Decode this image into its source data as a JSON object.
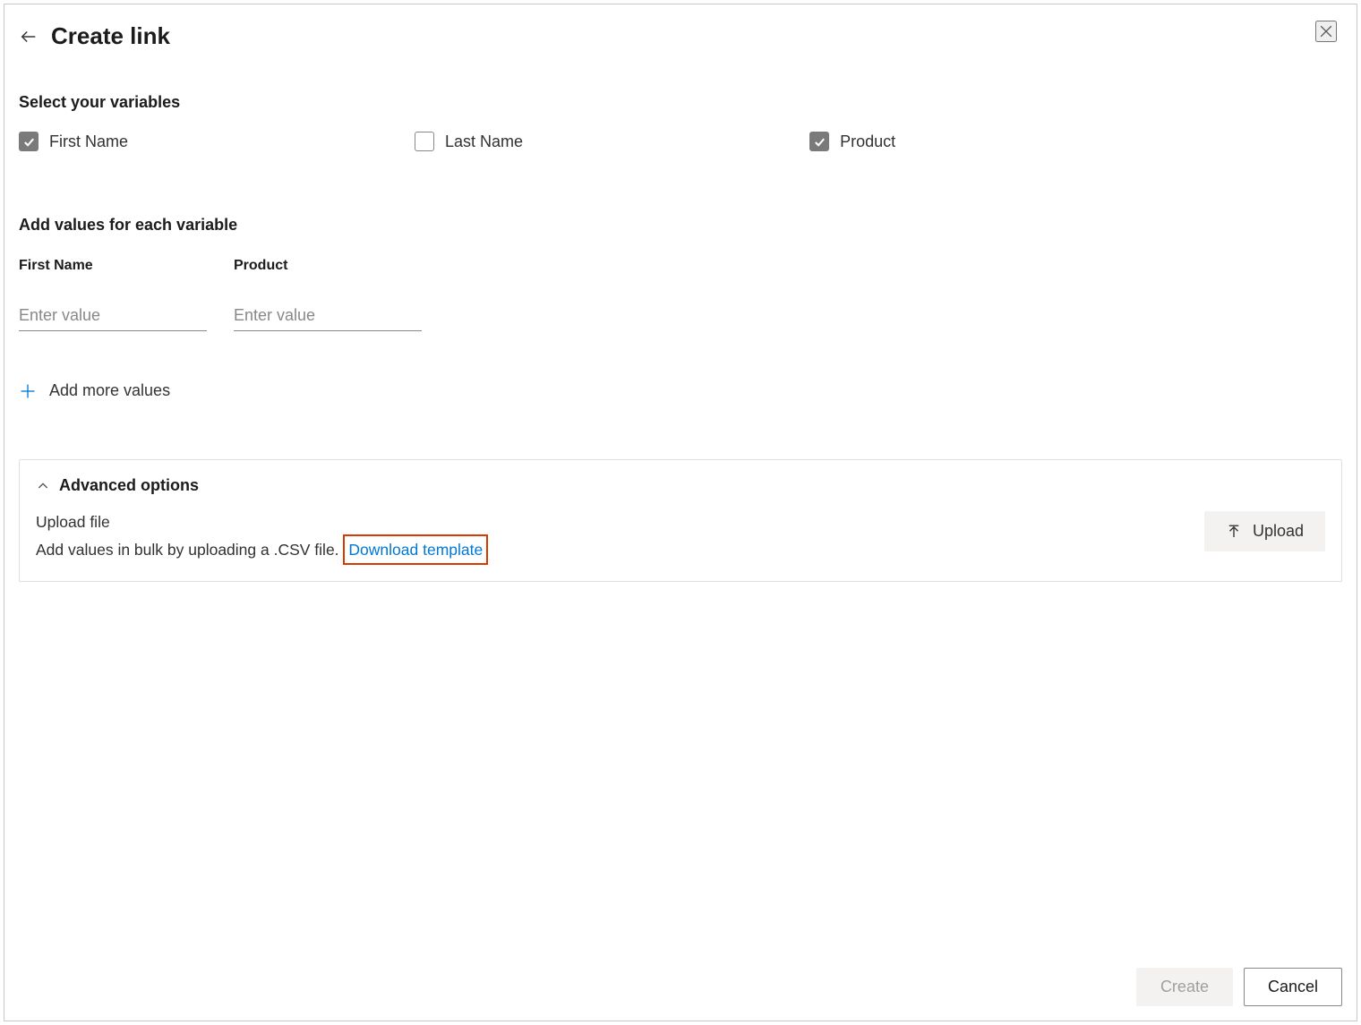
{
  "header": {
    "title": "Create link"
  },
  "variables": {
    "heading": "Select your variables",
    "items": [
      {
        "label": "First Name",
        "checked": true
      },
      {
        "label": "Last Name",
        "checked": false
      },
      {
        "label": "Product",
        "checked": true
      }
    ]
  },
  "values": {
    "heading": "Add values for each variable",
    "columns": [
      {
        "label": "First Name",
        "placeholder": "Enter value",
        "value": ""
      },
      {
        "label": "Product",
        "placeholder": "Enter value",
        "value": ""
      }
    ],
    "add_more_label": "Add more values"
  },
  "advanced": {
    "title": "Advanced options",
    "upload_heading": "Upload file",
    "upload_description": "Add values in bulk by uploading a .CSV file.",
    "download_link_label": "Download template",
    "upload_button_label": "Upload"
  },
  "footer": {
    "create_label": "Create",
    "cancel_label": "Cancel"
  }
}
